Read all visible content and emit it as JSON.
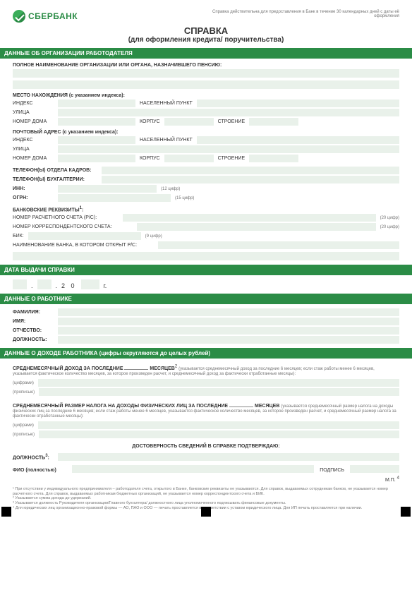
{
  "header": {
    "brand": "СБЕРБАНК",
    "topnote": "Справка действительна для предоставления в Банк в течение 30 календарных дней с даты её оформления",
    "title": "СПРАВКА",
    "subtitle": "(для оформления кредита/ поручительства)"
  },
  "sections": {
    "s1": "ДАННЫЕ ОБ ОРГАНИЗАЦИИ РАБОТОДАТЕЛЯ",
    "s2": "ДАТА ВЫДАЧИ СПРАВКИ",
    "s3": "ДАННЫЕ О РАБОТНИКЕ",
    "s4": "ДАННЫЕ О ДОХОДЕ РАБОТНИКА (цифры округляются до целых рублей)"
  },
  "org": {
    "full_name_label": "ПОЛНОЕ НАИМЕНОВАНИЕ ОРГАНИЗАЦИИ ИЛИ ОРГАНА, НАЗНАЧИВШЕГО ПЕНСИЮ:",
    "location_label": "МЕСТО НАХОЖДЕНИЯ (с указанием индекса):",
    "postal_label": "ПОЧТОВЫЙ АДРЕС (с указанием индекса):",
    "addr": {
      "index": "ИНДЕКС",
      "locality": "НАСЕЛЕННЫЙ ПУНКТ",
      "street": "УЛИЦА",
      "house": "НОМЕР ДОМА",
      "bld1": "КОРПУС",
      "bld2": "СТРОЕНИЕ"
    },
    "hr_phone": "ТЕЛЕФОН(Ы) ОТДЕЛА КАДРОВ:",
    "acc_phone": "ТЕЛЕФОН(Ы) БУХГАЛТЕРИИ:",
    "inn": "ИНН:",
    "inn_hint": "(12 цифр)",
    "ogrn": "ОГРН:",
    "ogrn_hint": "(15 цифр)",
    "bank_req": "БАНКОВСКИЕ РЕКВИЗИТЫ",
    "bank_req_sup": "1",
    "rs": "НОМЕР РАСЧЕТНОГО СЧЕТА (Р/С):",
    "ks": "НОМЕР КОРРЕСПОНДЕНТСКОГО СЧЕТА:",
    "digits20": "(20 цифр)",
    "bik": "БИК:",
    "bik_hint": "(9 цифр)",
    "bank_name": "НАИМЕНОВАНИЕ БАНКА, В КОТОРОМ ОТКРЫТ Р/С:"
  },
  "date": {
    "twenty": "2  0",
    "year_suffix": "г."
  },
  "employee": {
    "surname": "ФАМИЛИЯ:",
    "name": "ИМЯ:",
    "patronymic": "ОТЧЕСТВО:",
    "position": "ДОЛЖНОСТЬ:"
  },
  "income": {
    "line1_pre": "СРЕДНЕМЕСЯЧНЫЙ ДОХОД ЗА ПОСЛЕДНИЕ",
    "line1_mid": "МЕСЯЦЕВ",
    "line1_sup": "2",
    "line1_hint": "(указывается среднемесячный доход за последние 6 месяцев; если стаж работы менее 6 месяцев, указывается фактическое количество месяцев, за которое произведен расчет, и среднемесячный доход за фактически отработанные месяцы):",
    "digits": "(цифрами)",
    "words": "(прописью)",
    "line2_pre": "СРЕДНЕМЕСЯЧНЫЙ РАЗМЕР НАЛОГА НА ДОХОДЫ ФИЗИЧЕСКИХ ЛИЦ ЗА ПОСЛЕДНИЕ",
    "line2_mid": "МЕСЯЦЕВ",
    "line2_hint": "(указывается среднемесячный размер налога на доходы физических лиц за последние 6 месяцев; если стаж работы менее 6 месяцев, указывается фактическое количество месяцев, за которое произведен расчет, и среднемесячный размер налога за фактически отработанные месяцы):",
    "confirm": "ДОСТОВЕРНОСТЬ СВЕДЕНИЙ В СПРАВКЕ ПОДТВЕРЖДАЮ:",
    "position_label": "ДОЛЖНОСТЬ",
    "position_sup": "3",
    "fio_label": "ФИО (полностью)",
    "sign_label": "ПОДПИСЬ",
    "mp": "М.П.",
    "mp_sup": "4"
  },
  "footnotes": {
    "f1": "¹ При отсутствии у индивидуального предпринимателя – работодателя счета, открытого в Банке, банковские реквизиты не указываются. Для справок, выдаваемых сотрудникам банков, не указывается номер расчетного счета. Для справок, выдаваемых работникам бюджетных организаций, не указывается номер корреспондентского счета и БИК.",
    "f2": "² Указывается сумма дохода до удержаний.",
    "f3": "³ Указывается должность Руководителя организации/Главного бухгалтера/ должностного лица уполномоченного подписывать финансовые документы.",
    "f4": "⁴ Для юридических лиц организационно-правовой формы — АО, ПАО и ООО — печать проставляется в соответствии с уставом юридического лица. Для ИП печать проставляется при наличии."
  }
}
